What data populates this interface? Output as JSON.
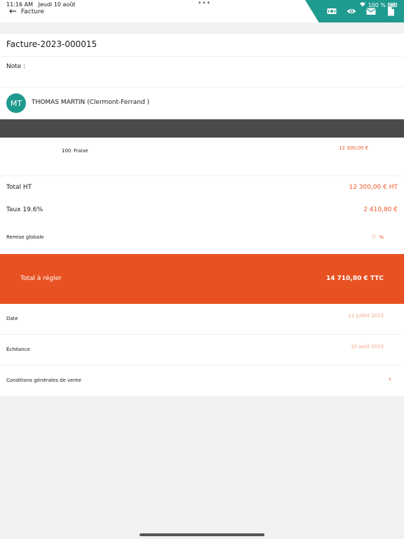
{
  "status_bar": {
    "time": "11:16 AM",
    "date": "Jeudi 10 août",
    "dots": "•••",
    "battery": "100 %"
  },
  "header": {
    "back_label": "Facture",
    "back_icon": "arrow-left-icon",
    "actions": [
      "cash-icon",
      "eye-icon",
      "mail-icon",
      "document-icon"
    ],
    "accent": "#1f9a8f"
  },
  "invoice": {
    "number": "Facture-2023-000015",
    "note_label": "Note :"
  },
  "client": {
    "initials": "MT",
    "name": "THOMAS MARTIN (Clermont-Ferrand )"
  },
  "items": [
    {
      "qty": "100",
      "name": "Fraise",
      "price": "12 300,00 €"
    }
  ],
  "totals": {
    "ht_label": "Total HT",
    "ht_value": "12 300,00 € HT",
    "tax_label": "Taux 19.6%",
    "tax_value": "2 410,80 €",
    "discount_label": "Remise globale",
    "discount_value": "0",
    "discount_unit": "%"
  },
  "total_due": {
    "label": "Total à régler",
    "value": "14 710,80 € TTC",
    "color": "#e85222"
  },
  "details": {
    "date_label": "Date",
    "date_value": "11 juillet 2023",
    "due_label": "Échéance",
    "due_value": "10 août 2023",
    "terms_label": "Conditions générales de vente"
  }
}
